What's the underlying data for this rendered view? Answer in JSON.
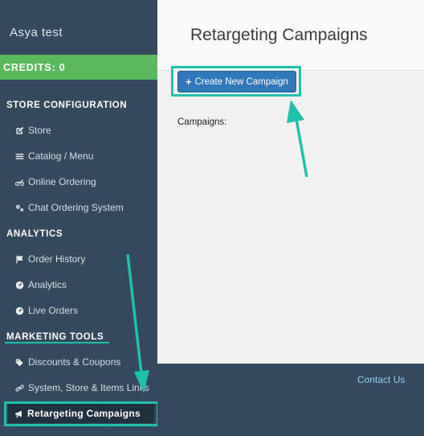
{
  "sidebar": {
    "brand": "Asya test",
    "credits": "CREDITS: 0",
    "sections": {
      "store_config": "STORE CONFIGURATION",
      "analytics": "ANALYTICS",
      "marketing": "MARKETING TOOLS"
    },
    "items": {
      "store": "Store",
      "catalog": "Catalog / Menu",
      "online_ordering": "Online Ordering",
      "chat_ordering": "Chat Ordering System",
      "order_history": "Order History",
      "analytics": "Analytics",
      "live_orders": "Live Orders",
      "discounts": "Discounts & Coupons",
      "links": "System, Store & Items Links",
      "retargeting": "Retargeting Campaigns"
    }
  },
  "main": {
    "title": "Retargeting Campaigns",
    "create_button": "Create New Campaign",
    "create_button_icon": "+",
    "campaigns_label": "Campaigns:"
  },
  "footer": {
    "contact": "Contact Us"
  },
  "colors": {
    "sidebar": "#34495e",
    "credits": "#5cb85c",
    "primary_button": "#3178b8",
    "highlight": "#1fc1aa"
  }
}
